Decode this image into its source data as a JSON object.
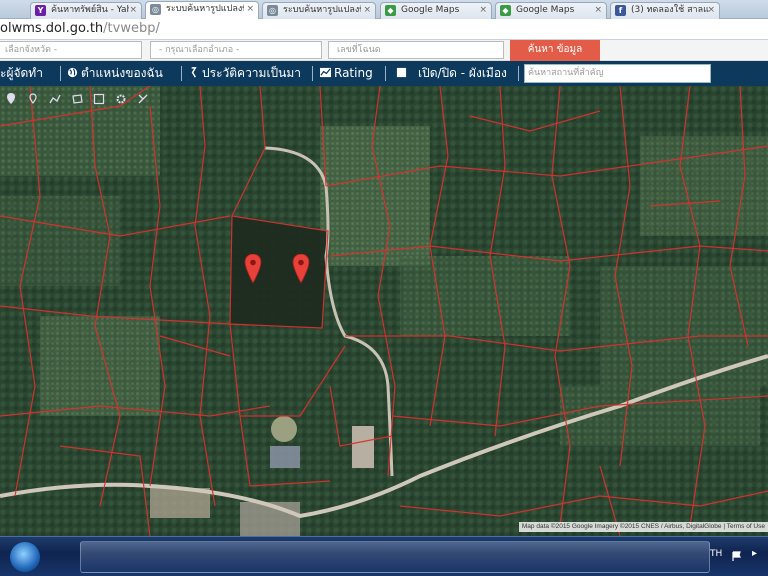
{
  "browser": {
    "tabs": [
      {
        "label": "ค้นหาทรัพย์สิน - Yah",
        "favicon": "Y",
        "favicon_color": "#6b1fa6",
        "active": false
      },
      {
        "label": "ระบบค้นหารูปแปลงที่ดิน",
        "favicon": "◎",
        "favicon_color": "#7a8a99",
        "active": true
      },
      {
        "label": "ระบบค้นหารูปแปลงที่",
        "favicon": "◎",
        "favicon_color": "#7a8a99",
        "active": false
      },
      {
        "label": "Google Maps",
        "favicon": "◆",
        "favicon_color": "#3a9b46",
        "active": false
      },
      {
        "label": "Google Maps",
        "favicon": "◆",
        "favicon_color": "#3a9b46",
        "active": false
      },
      {
        "label": "(3) ทดลองใช้ สาลแม่",
        "favicon": "f",
        "favicon_color": "#3b5998",
        "active": false
      }
    ],
    "close_glyph": "×",
    "address": {
      "host": "olwms.dol.go.th",
      "path": "/tvwebp/"
    }
  },
  "form": {
    "province_placeholder": "เลือกจังหวัด -",
    "district_placeholder": "- กรุณาเลือกอำเภอ -",
    "parcel_placeholder": "เลขที่โฉนด",
    "submit_label": "ค้นหา ข้อมูล"
  },
  "nav": {
    "items": [
      {
        "label": "ะผู้จัดทำ",
        "icon": "none"
      },
      {
        "label": "ตำแหน่งของฉัน",
        "icon": "globe-icon"
      },
      {
        "label": "ประวัติความเป็นมา",
        "icon": "history-icon"
      },
      {
        "label": "Rating",
        "icon": "chart-icon"
      },
      {
        "label": "เปิด/ปิด - ผังเมือง",
        "icon": "square-icon"
      }
    ],
    "search_placeholder": "ค้นหาสถานที่สำคัญ"
  },
  "map": {
    "tools": [
      "pin-tool-icon",
      "pin-outline-tool-icon",
      "polyline-tool-icon",
      "polygon-tool-icon",
      "area-tool-icon",
      "gear-tool-icon",
      "eraser-tool-icon"
    ],
    "marker_count": 2,
    "marker_color": "#e8413b",
    "parcel_line_color": "#d8322e",
    "attribution": "Map data ©2015 Google Imagery ©2015 CNES / Airbus, DigitalGlobe  |  Terms of Use"
  },
  "taskbar": {
    "language": "TH"
  }
}
